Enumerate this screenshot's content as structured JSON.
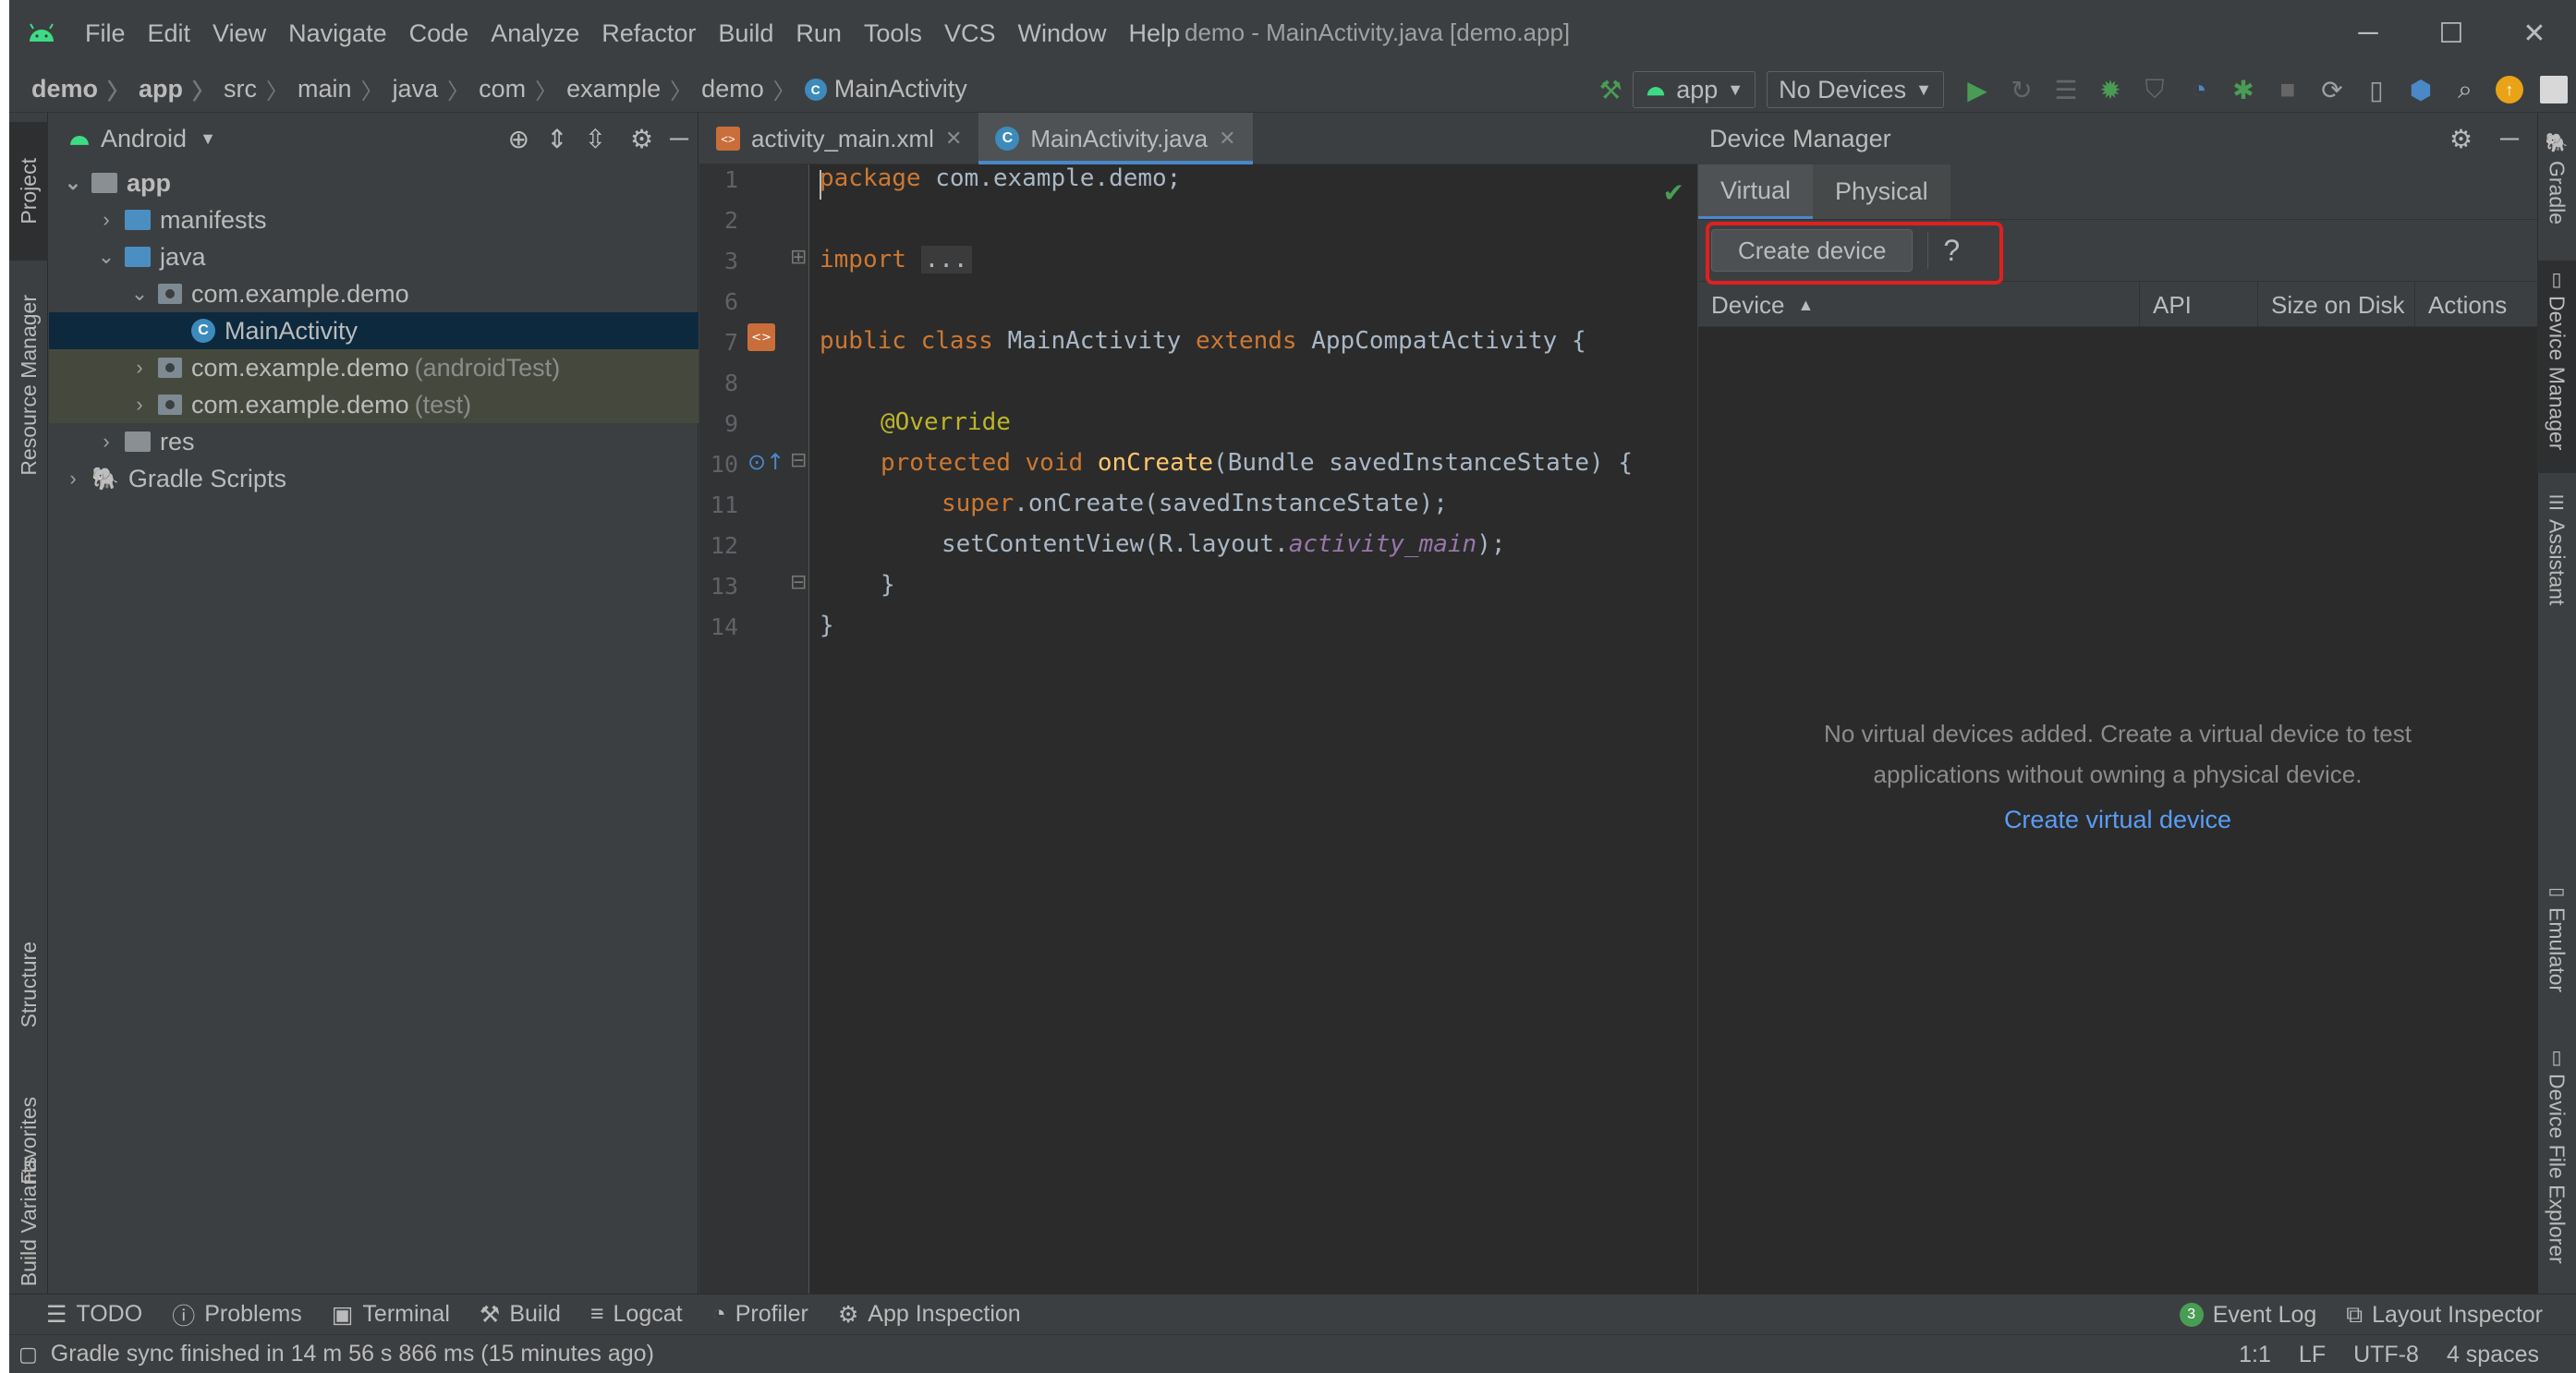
{
  "menu": {
    "items": [
      "File",
      "Edit",
      "View",
      "Navigate",
      "Code",
      "Analyze",
      "Refactor",
      "Build",
      "Run",
      "Tools",
      "VCS",
      "Window",
      "Help"
    ],
    "window_title": "demo - MainActivity.java [demo.app]"
  },
  "breadcrumb": [
    "demo",
    "app",
    "src",
    "main",
    "java",
    "com",
    "example",
    "demo",
    "MainActivity"
  ],
  "toolbar": {
    "config": "app",
    "device": "No Devices"
  },
  "left_tabs": {
    "project": "Project",
    "resource_manager": "Resource Manager",
    "structure": "Structure",
    "favorites": "Favorites",
    "build_variants": "Build Variants"
  },
  "right_tabs": {
    "gradle": "Gradle",
    "device_manager": "Device Manager",
    "assistant": "Assistant",
    "emulator": "Emulator",
    "device_file_explorer": "Device File Explorer"
  },
  "project": {
    "view": "Android",
    "tree": [
      {
        "label": "app",
        "suffix": ""
      },
      {
        "label": "manifests",
        "suffix": ""
      },
      {
        "label": "java",
        "suffix": ""
      },
      {
        "label": "com.example.demo",
        "suffix": ""
      },
      {
        "label": "MainActivity",
        "suffix": ""
      },
      {
        "label": "com.example.demo",
        "suffix": "(androidTest)"
      },
      {
        "label": "com.example.demo",
        "suffix": "(test)"
      },
      {
        "label": "res",
        "suffix": ""
      },
      {
        "label": "Gradle Scripts",
        "suffix": ""
      }
    ]
  },
  "editor": {
    "tabs": [
      {
        "label": "activity_main.xml"
      },
      {
        "label": "MainActivity.java"
      }
    ],
    "line_numbers": [
      "1",
      "2",
      "3",
      "6",
      "7",
      "8",
      "9",
      "10",
      "11",
      "12",
      "13",
      "14"
    ],
    "code": {
      "l1_kw": "package",
      "l1_rest": " com.example.demo;",
      "l3_kw": "import",
      "l3_fold": "...",
      "l7_kw1": "public class",
      "l7_mid": " MainActivity ",
      "l7_kw2": "extends",
      "l7_rest": " AppCompatActivity {",
      "l9_an": "@Override",
      "l10_kw": "protected void",
      "l10_fn": "onCreate",
      "l10_rest": "(Bundle savedInstanceState) {",
      "l11_kw": "super",
      "l11_rest": ".onCreate(savedInstanceState);",
      "l12_a": "setContentView(R.layout.",
      "l12_it": "activity_main",
      "l12_b": ");",
      "l13": "}",
      "l14": "}"
    }
  },
  "device_manager": {
    "title": "Device Manager",
    "tabs": [
      "Virtual",
      "Physical"
    ],
    "create_button": "Create device",
    "help": "?",
    "columns": [
      "Device",
      "API",
      "Size on Disk",
      "Actions"
    ],
    "empty_line1": "No virtual devices added. Create a virtual device to test",
    "empty_line2": "applications without owning a physical device.",
    "empty_link": "Create virtual device"
  },
  "bottom_tools": [
    "TODO",
    "Problems",
    "Terminal",
    "Build",
    "Logcat",
    "Profiler",
    "App Inspection"
  ],
  "bottom_right": {
    "event_count": "3",
    "event_log": "Event Log",
    "layout_inspector": "Layout Inspector"
  },
  "status": {
    "message": "Gradle sync finished in 14 m 56 s 866 ms (15 minutes ago)",
    "position": "1:1",
    "line_sep": "LF",
    "encoding": "UTF-8",
    "indent": "4 spaces"
  },
  "colors": {
    "accent": "#4a88c7",
    "highlight": "#e02020",
    "link": "#589df6"
  }
}
